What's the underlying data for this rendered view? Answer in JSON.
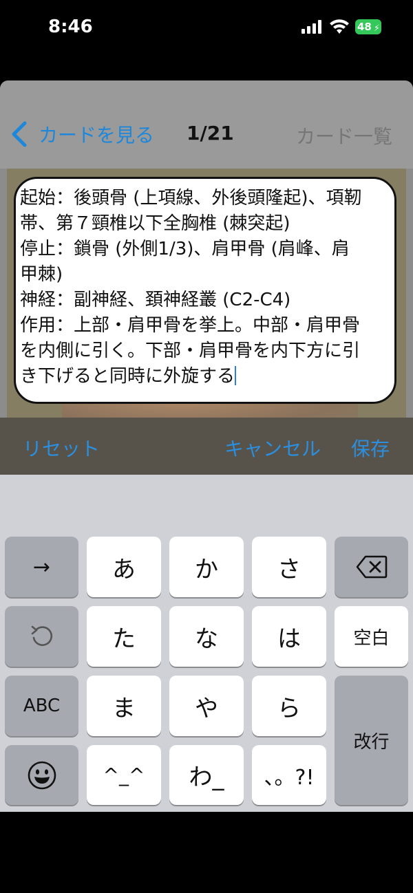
{
  "status_bar": {
    "time": "8:46",
    "battery": "48",
    "icons": [
      "cellular-signal-icon",
      "wifi-icon",
      "battery-charging-icon"
    ]
  },
  "nav": {
    "back_label": "カードを見る",
    "counter": "1/21",
    "right_label": "カード一覧"
  },
  "card": {
    "text": "起始：後頭骨 (上項線、外後頭隆起)、項靭\n帯、第７頸椎以下全胸椎 (棘突起)\n停止：鎖骨 (外側1/3)、肩甲骨 (肩峰、肩\n甲棘)\n神経：副神経、頚神経叢 (C2-C4)\n作用：上部・肩甲骨を挙上。中部・肩甲骨\nを内側に引く。下部・肩甲骨を内下方に引\nき下げると同時に外旋する"
  },
  "toolbar": {
    "reset": "リセット",
    "cancel": "キャンセル",
    "save": "保存"
  },
  "keyboard": {
    "row1": [
      "→",
      "あ",
      "か",
      "さ",
      "⌫"
    ],
    "row2": [
      "undo",
      "た",
      "な",
      "は",
      "空白"
    ],
    "row3": [
      "ABC",
      "ま",
      "や",
      "ら",
      "改行"
    ],
    "row4": [
      "emoji",
      "^_^",
      "わ_",
      "、。?!"
    ]
  },
  "colors": {
    "accent": "#2b8fe0",
    "battery": "#34c759"
  }
}
